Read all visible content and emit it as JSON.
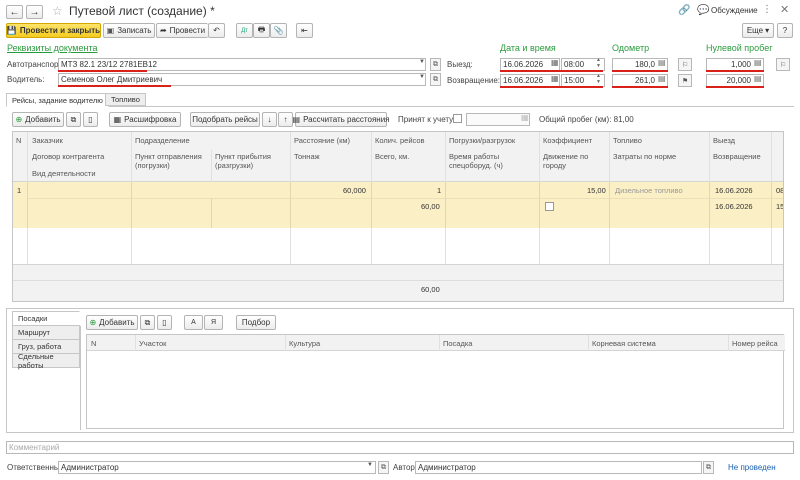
{
  "window": {
    "title": "Путевой лист (создание) *",
    "discuss": "Обсуждение"
  },
  "toolbar": {
    "post_close": "Провести и закрыть",
    "save": "Записать",
    "post": "Провести",
    "more": "Еще"
  },
  "requisites": {
    "title": "Реквизиты документа",
    "vehicle_label": "Автотранспорт:",
    "vehicle_value": "МТЗ 82.1 23/12 2781ЕВ12",
    "driver_label": "Водитель:",
    "driver_value": "Семенов Олег Дмитриевич"
  },
  "datetime": {
    "title": "Дата и время",
    "depart_label": "Выезд:",
    "depart_date": "16.06.2026",
    "depart_time": "08:00",
    "return_label": "Возвращение:",
    "return_date": "16.06.2026",
    "return_time": "15:00"
  },
  "odometer": {
    "title": "Одометр",
    "depart": "180,0",
    "return": "261,0"
  },
  "zero_run": {
    "title": "Нулевой пробег",
    "depart": "1,000",
    "return": "20,000"
  },
  "tabs": {
    "trips": "Рейсы, задание водителю",
    "fuel": "Топливо"
  },
  "trips_toolbar": {
    "add": "Добавить",
    "decode": "Расшифровка",
    "pick": "Подобрать рейсы",
    "calc": "Рассчитать расстояния",
    "accepted": "Принят к учету:",
    "total": "Общий пробег (км): 81,00"
  },
  "grid": {
    "col_n": "N",
    "col1": [
      "Заказчик",
      "Договор контрагента",
      "Вид деятельности"
    ],
    "col2": [
      "Подразделение",
      "Пункт отправления (погрузки)"
    ],
    "col3": [
      "Пункт прибытия (разгрузки)"
    ],
    "col4": [
      "Расстояние (км)",
      "Тоннаж"
    ],
    "col5": [
      "Колич. рейсов",
      "Всего, км."
    ],
    "col6": [
      "Погрузки/разгрузок",
      "Время работы спецоборуд. (ч)"
    ],
    "col7": [
      "Коэффициент",
      "Движение по городу"
    ],
    "col8": [
      "Топливо",
      "Затраты по норме"
    ],
    "col9": [
      "Выезд",
      "Возвращение"
    ],
    "row": {
      "n": "1",
      "distance": "60,000",
      "trips": "1",
      "total_km": "60,00",
      "coef": "15,00",
      "fuel": "Дизельное топливо",
      "depart": "16.06.2026",
      "return": "16.06.2026",
      "depart_t": "08",
      "return_t": "15"
    },
    "footer_total": "60,00"
  },
  "lower": {
    "side_tabs": [
      "Посадки",
      "Маршрут",
      "Груз, работа",
      "Сдельные работы"
    ],
    "add": "Добавить",
    "pick": "Подбор",
    "a_btn": "А",
    "ya_btn": "Я",
    "cols": [
      "N",
      "Участок",
      "Культура",
      "Посадка",
      "Корневая система",
      "Номер рейса"
    ]
  },
  "comment_placeholder": "Комментарий",
  "footer": {
    "resp_label": "Ответственный:",
    "resp_value": "Администратор",
    "author_label": "Автор:",
    "author_value": "Администратор",
    "status": "Не проведен"
  }
}
